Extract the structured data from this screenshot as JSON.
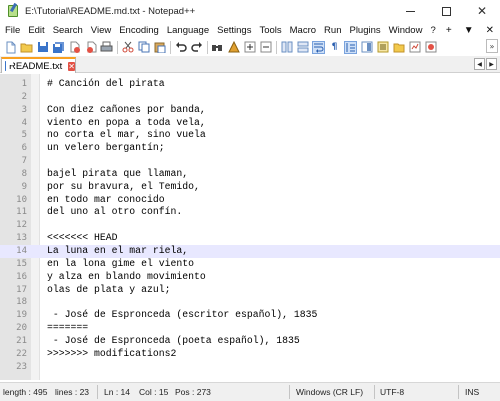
{
  "window": {
    "title": "E:\\Tutorial\\README.md.txt - Notepad++"
  },
  "menu": {
    "items": [
      "File",
      "Edit",
      "Search",
      "View",
      "Encoding",
      "Language",
      "Settings",
      "Tools",
      "Macro",
      "Run",
      "Plugins",
      "Window",
      "?"
    ],
    "right": [
      "+",
      "▼",
      "✕"
    ]
  },
  "toolbar": {
    "icons": [
      "new-file-icon",
      "open-file-icon",
      "save-icon",
      "save-all-icon",
      "close-icon",
      "close-all-icon",
      "print-icon",
      "cut-icon",
      "copy-icon",
      "paste-icon",
      "undo-icon",
      "redo-icon",
      "find-icon",
      "replace-icon",
      "zoom-in-icon",
      "zoom-out-icon",
      "sync-vertical-icon",
      "sync-horizontal-icon",
      "word-wrap-icon",
      "show-all-chars-icon",
      "indent-guide-icon",
      "document-map-icon",
      "function-list-icon",
      "folder-workspace-icon",
      "monitoring-icon",
      "record-macro-icon"
    ],
    "more": "»"
  },
  "tabs": [
    {
      "label": "README.txt",
      "active": true
    }
  ],
  "editor": {
    "current_line": 14,
    "lines": [
      {
        "n": "1",
        "text": "# Canción del pirata"
      },
      {
        "n": "2",
        "text": ""
      },
      {
        "n": "3",
        "text": "Con diez cañones por banda,"
      },
      {
        "n": "4",
        "text": "viento en popa a toda vela,"
      },
      {
        "n": "5",
        "text": "no corta el mar, sino vuela"
      },
      {
        "n": "6",
        "text": "un velero bergantín;"
      },
      {
        "n": "7",
        "text": ""
      },
      {
        "n": "8",
        "text": "bajel pirata que llaman,"
      },
      {
        "n": "9",
        "text": "por su bravura, el Temido,"
      },
      {
        "n": "10",
        "text": "en todo mar conocido"
      },
      {
        "n": "11",
        "text": "del uno al otro confín."
      },
      {
        "n": "12",
        "text": ""
      },
      {
        "n": "13",
        "text": "<<<<<<< HEAD"
      },
      {
        "n": "14",
        "text": "La luna en el mar riela,"
      },
      {
        "n": "15",
        "text": "en la lona gime el viento"
      },
      {
        "n": "16",
        "text": "y alza en blando movimiento"
      },
      {
        "n": "17",
        "text": "olas de plata y azul;"
      },
      {
        "n": "18",
        "text": ""
      },
      {
        "n": "19",
        "text": " - José de Espronceda (escritor español), 1835"
      },
      {
        "n": "20",
        "text": "======="
      },
      {
        "n": "21",
        "text": " - José de Espronceda (poeta español), 1835"
      },
      {
        "n": "22",
        "text": ">>>>>>> modifications2"
      },
      {
        "n": "23",
        "text": ""
      }
    ]
  },
  "status": {
    "length": "length : 495",
    "lines": "lines : 23",
    "ln": "Ln : 14",
    "col": "Col : 15",
    "pos": "Pos : 273",
    "eol": "Windows (CR LF)",
    "encoding": "UTF-8",
    "mode": "INS"
  },
  "colors": {
    "current_line": "#e8e8ff",
    "gutter": "#e4e4e4",
    "tab_accent": "#f9a020"
  }
}
